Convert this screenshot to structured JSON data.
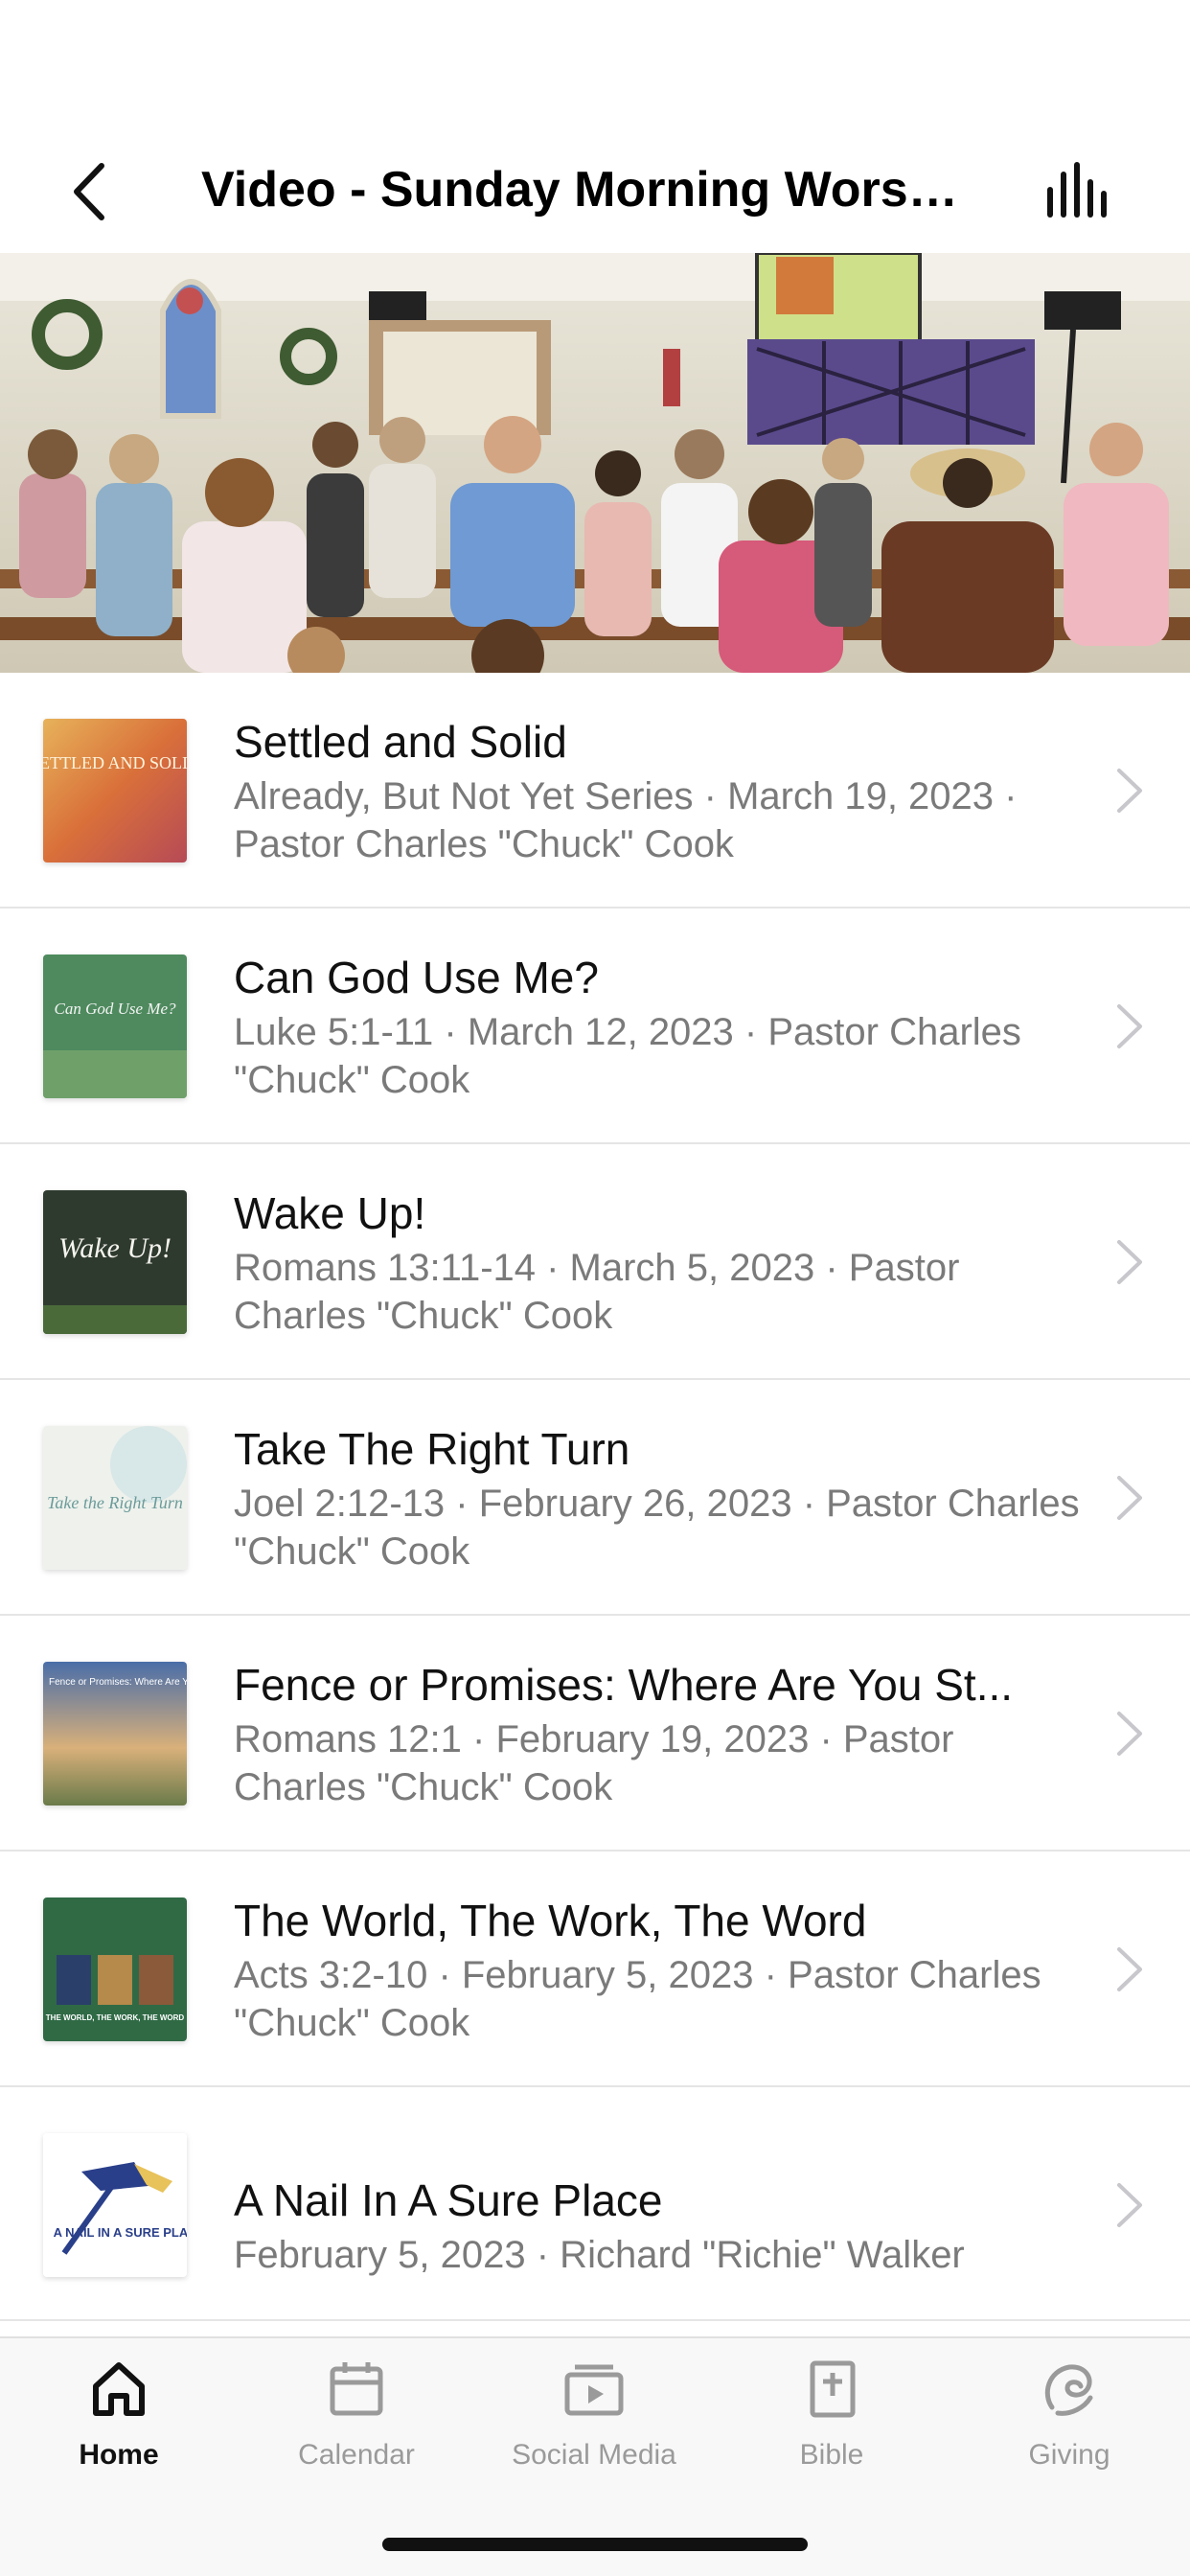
{
  "header": {
    "title": "Video - Sunday Morning Worshi...",
    "back_icon": "chevron-left-icon",
    "audio_icon": "equalizer-icon"
  },
  "hero": {
    "image": "congregation-worship-photo"
  },
  "items": [
    {
      "title": "Settled and Solid",
      "subtitle": "Already, But Not Yet Series · March 19, 2023 · Pastor Charles \"Chuck\" Cook",
      "thumb_text": "SETTLED AND SOLID"
    },
    {
      "title": "Can God Use Me?",
      "subtitle": "Luke 5:1-11 · March 12, 2023 · Pastor Charles \"Chuck\" Cook",
      "thumb_text": "Can God Use Me?"
    },
    {
      "title": "Wake Up!",
      "subtitle": "Romans 13:11-14 · March 5, 2023 · Pastor Charles \"Chuck\" Cook",
      "thumb_text": "Wake Up!"
    },
    {
      "title": "Take The Right Turn",
      "subtitle": "Joel 2:12-13 · February 26, 2023 · Pastor Charles \"Chuck\" Cook",
      "thumb_text": "Take the Right Turn"
    },
    {
      "title": "Fence or Promises: Where Are You St...",
      "subtitle": "Romans 12:1 · February 19, 2023 · Pastor Charles \"Chuck\" Cook",
      "thumb_text": "Fence or Promises: Where Are You Standing"
    },
    {
      "title": "The World, The Work, The Word",
      "subtitle": "Acts 3:2-10 · February 5, 2023 · Pastor Charles \"Chuck\" Cook",
      "thumb_text": "THE WORLD, THE WORK, THE WORD"
    },
    {
      "title": "A Nail In A Sure Place",
      "subtitle": "February 5, 2023 · Richard \"Richie\" Walker",
      "thumb_text": "A NAIL IN A SURE PLACE"
    }
  ],
  "tabs": [
    {
      "label": "Home",
      "icon": "home-icon",
      "active": true
    },
    {
      "label": "Calendar",
      "icon": "calendar-icon",
      "active": false
    },
    {
      "label": "Social Media",
      "icon": "video-play-icon",
      "active": false
    },
    {
      "label": "Bible",
      "icon": "bible-icon",
      "active": false
    },
    {
      "label": "Giving",
      "icon": "giving-icon",
      "active": false
    }
  ],
  "colors": {
    "active_tab": "#111111",
    "inactive_tab": "#9a9a9a",
    "subtitle": "#7a7a7a",
    "divider": "#e5e5e5"
  }
}
